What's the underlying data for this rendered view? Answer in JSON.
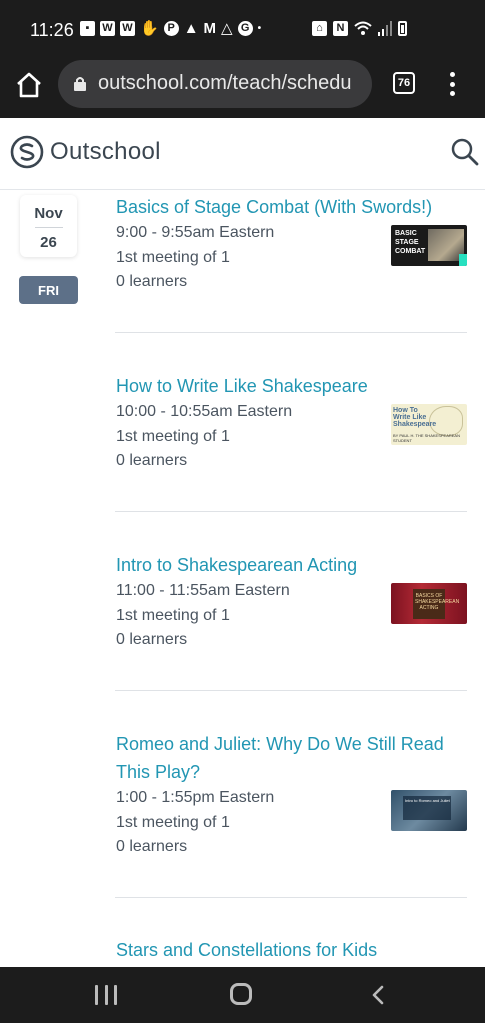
{
  "status_bar": {
    "time": "11:26",
    "left_icons": [
      "chat-icon",
      "w-icon",
      "w-icon",
      "hand-icon",
      "pinterest-icon",
      "warning-icon",
      "gmail-icon",
      "drive-icon",
      "google-icon",
      "dot-icon"
    ],
    "right_icons": [
      "nfc-icon",
      "n-icon",
      "wifi-icon",
      "signal-icon",
      "battery-icon"
    ]
  },
  "browser": {
    "url": "outschool.com/teach/schedu",
    "tab_count": "76"
  },
  "site": {
    "logo_text": "Outschool",
    "brand_color": "#2296b3"
  },
  "date": {
    "month": "Nov",
    "day": "26",
    "weekday": "FRI"
  },
  "classes": [
    {
      "title": "Basics of Stage Combat (With Swords!)",
      "time": "9:00 - 9:55am Eastern",
      "meeting": "1st meeting of 1",
      "learners": "0 learners",
      "thumb_text": [
        "BASIC",
        "STAGE",
        "COMBAT"
      ]
    },
    {
      "title": "How to Write Like Shakespeare",
      "time": "10:00 - 10:55am Eastern",
      "meeting": "1st meeting of 1",
      "learners": "0 learners",
      "thumb_text": [
        "How To",
        "Write Like",
        "Shakespeare"
      ],
      "thumb_sub": "BY PAUL H. THE SHAKESPEAREAN STUDENT"
    },
    {
      "title": "Intro to Shakespearean Acting",
      "time": "11:00 - 11:55am Eastern",
      "meeting": "1st meeting of 1",
      "learners": "0 learners",
      "thumb_text": [
        "BASICS OF",
        "SHAKESPEAREAN",
        "ACTING"
      ]
    },
    {
      "title_line1": "Romeo and Juliet: Why Do We Still Read",
      "title_line2": "This Play?",
      "time": "1:00 - 1:55pm Eastern",
      "meeting": "1st meeting of 1",
      "learners": "0 learners",
      "thumb_text": [
        "Intro to Romeo and Juliet"
      ]
    },
    {
      "title": "Stars and Constellations for Kids"
    }
  ]
}
